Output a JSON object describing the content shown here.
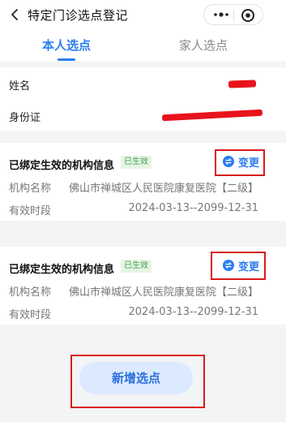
{
  "header": {
    "title": "特定门诊选点登记"
  },
  "tabs": [
    {
      "label": "本人选点",
      "active": true
    },
    {
      "label": "家人选点",
      "active": false
    }
  ],
  "person": {
    "name_label": "姓名",
    "id_label": "身份证"
  },
  "org_cards": [
    {
      "title": "已绑定生效的机构信息",
      "badge": "已生效",
      "change_label": "变更",
      "org_label": "机构名称",
      "org_value": "佛山市禅城区人民医院康复医院【二级】",
      "period_label": "有效时段",
      "period_value": "2024-03-13--2099-12-31"
    },
    {
      "title": "已绑定生效的机构信息",
      "badge": "已生效",
      "change_label": "变更",
      "org_label": "机构名称",
      "org_value": "佛山市禅城区人民医院康复医院【二级】",
      "period_label": "有效时段",
      "period_value": "2024-03-13--2099-12-31"
    }
  ],
  "add_button": "新增选点",
  "colors": {
    "accent": "#2a7df1",
    "badge_green": "#43a047",
    "annotation_red": "#d91a1a",
    "redaction_red": "#e8141c"
  },
  "icons": [
    "back-chevron-icon",
    "more-dots-icon",
    "target-icon",
    "swap-icon"
  ]
}
